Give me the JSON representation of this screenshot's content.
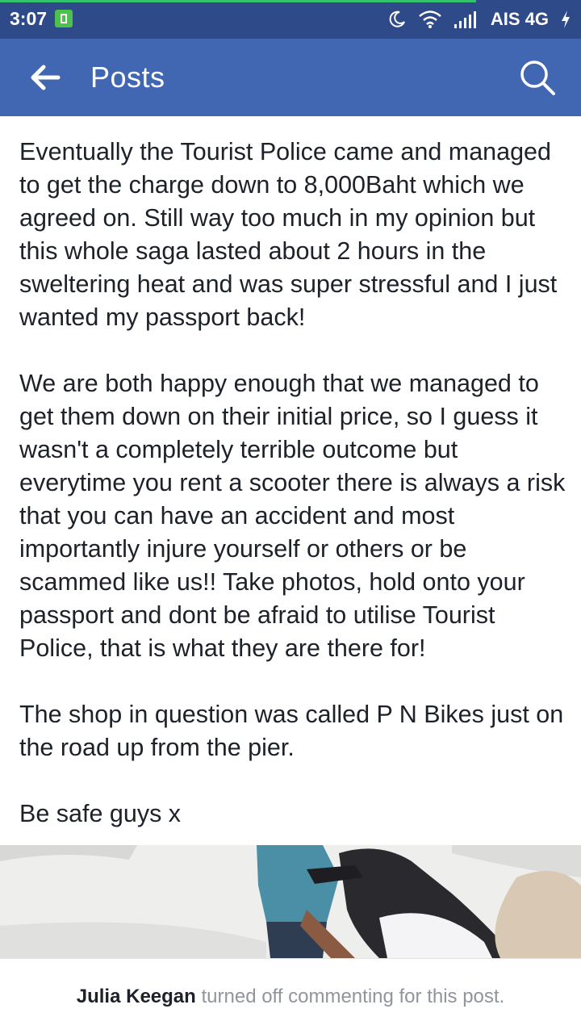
{
  "status_bar": {
    "time": "3:07",
    "carrier": "AIS 4G",
    "icons": [
      "battery-icon",
      "moon-icon",
      "wifi-icon",
      "signal-icon",
      "charging-icon"
    ]
  },
  "app_bar": {
    "title": "Posts",
    "icons": [
      "back-arrow-icon",
      "search-icon"
    ]
  },
  "post": {
    "paragraphs": [
      "Eventually the Tourist Police came and managed to get the charge down to 8,000Baht which we agreed on. Still way too much in my opinion but this whole saga lasted about 2 hours in the sweltering heat and was super stressful and I just wanted my passport back!",
      "We are both happy enough that we managed to get them down on their initial price, so I guess it wasn't a completely terrible outcome but everytime you rent a scooter there is always a risk that you can have an accident and most importantly injure yourself or others or be scammed like us!! Take photos, hold onto your passport and dont be afraid to utilise Tourist Police, that is what they are there for!",
      "The shop in question was called  P N Bikes just on the road up from the pier.",
      "Be safe guys x"
    ]
  },
  "footer": {
    "author": "Julia Keegan",
    "message": "turned off commenting for this post."
  },
  "colors": {
    "status_bar": "#2f4a88",
    "app_bar": "#4267b2",
    "text": "#1d2129",
    "muted": "#90949c"
  }
}
